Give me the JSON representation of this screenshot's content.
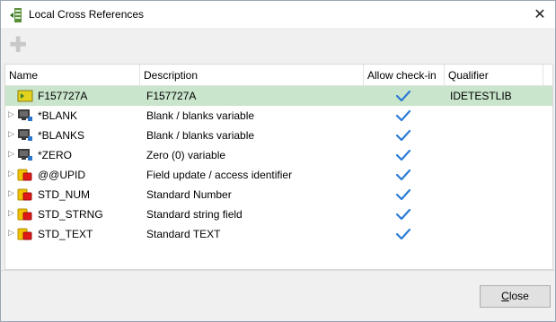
{
  "window": {
    "title": "Local Cross References",
    "close_glyph": "✕"
  },
  "toolbar": {
    "add_icon": "plus-icon",
    "add_glyph": "✚"
  },
  "table": {
    "columns": [
      "Name",
      "Description",
      "Allow check-in",
      "Qualifier"
    ],
    "rows": [
      {
        "name": "F157727A",
        "description": "F157727A",
        "allow_checkin": true,
        "qualifier": "IDETESTLIB",
        "icon": "file-icon",
        "selected": true,
        "expandable": false
      },
      {
        "name": "*BLANK",
        "description": "Blank / blanks variable",
        "allow_checkin": true,
        "qualifier": "",
        "icon": "system-variable-icon",
        "selected": false,
        "expandable": true
      },
      {
        "name": "*BLANKS",
        "description": "Blank / blanks variable",
        "allow_checkin": true,
        "qualifier": "",
        "icon": "system-variable-icon",
        "selected": false,
        "expandable": true
      },
      {
        "name": "*ZERO",
        "description": "Zero (0) variable",
        "allow_checkin": true,
        "qualifier": "",
        "icon": "system-variable-icon",
        "selected": false,
        "expandable": true
      },
      {
        "name": "@@UPID",
        "description": "Field update / access identifier",
        "allow_checkin": true,
        "qualifier": "",
        "icon": "field-icon",
        "selected": false,
        "expandable": true
      },
      {
        "name": "STD_NUM",
        "description": "Standard Number",
        "allow_checkin": true,
        "qualifier": "",
        "icon": "field-icon",
        "selected": false,
        "expandable": true
      },
      {
        "name": "STD_STRNG",
        "description": "Standard string field",
        "allow_checkin": true,
        "qualifier": "",
        "icon": "field-icon",
        "selected": false,
        "expandable": true
      },
      {
        "name": "STD_TEXT",
        "description": "Standard TEXT",
        "allow_checkin": true,
        "qualifier": "",
        "icon": "field-icon",
        "selected": false,
        "expandable": true
      }
    ]
  },
  "footer": {
    "close_label_underlined": "C",
    "close_label_rest": "lose"
  },
  "colors": {
    "selected_row": "#c9e5cb",
    "check": "#2a7bd6"
  }
}
